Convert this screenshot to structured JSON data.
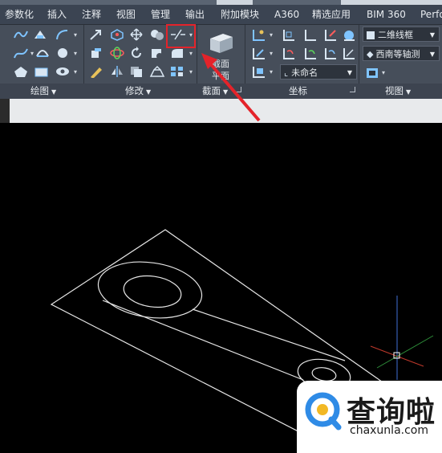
{
  "tabs": [
    "参数化",
    "插入",
    "注释",
    "视图",
    "管理",
    "输出",
    "附加模块",
    "A360",
    "精选应用",
    "BIM 360",
    "Perfo"
  ],
  "panels": {
    "draw": "绘图",
    "modify": "修改",
    "section": "截面",
    "coordinates": "坐标",
    "view": "视图"
  },
  "section_button": {
    "line1": "截面",
    "line2": "平面"
  },
  "ucs_combo": "未命名",
  "visual_style_combo": "二维线框",
  "view_combo": "西南等轴测",
  "watermark": {
    "brand": "查询啦",
    "url": "chaxunla.com"
  },
  "colors": {
    "ribbon_bg": "#464e5a",
    "tab_bg": "#3b4452",
    "highlight": "#e4232a",
    "canvas_bg": "#000000",
    "watermark_accent": "#2f8be6"
  },
  "highlighted_tool": "dash-slash-icon"
}
